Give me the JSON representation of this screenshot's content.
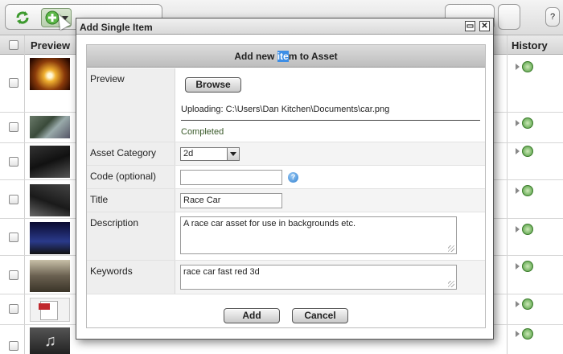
{
  "table": {
    "headers": {
      "preview": "Preview",
      "history": "History"
    }
  },
  "dialog": {
    "title": "Add Single Item",
    "heading_pre": "Add new ",
    "heading_highlight": "ite",
    "heading_post": "m to Asset",
    "fields": {
      "preview_label": "Preview",
      "browse_label": "Browse",
      "uploading_text": "Uploading: C:\\Users\\Dan Kitchen\\Documents\\car.png",
      "completed_text": "Completed",
      "category_label": "Asset Category",
      "category_value": "2d",
      "code_label": "Code (optional)",
      "code_value": "",
      "help_glyph": "?",
      "title_label": "Title",
      "title_value": "Race Car",
      "description_label": "Description",
      "description_value": "A race car asset for use in backgrounds etc.",
      "keywords_label": "Keywords",
      "keywords_value": "race car fast red 3d"
    },
    "add_label": "Add",
    "cancel_label": "Cancel",
    "minimize_glyph": "▭",
    "close_glyph": "✕"
  },
  "icons": {
    "refresh": "refresh-icon",
    "add": "add-icon",
    "history": "history-icon"
  },
  "colors": {
    "accent_green": "#4a9a3a",
    "highlight": "#3d8ee6"
  }
}
